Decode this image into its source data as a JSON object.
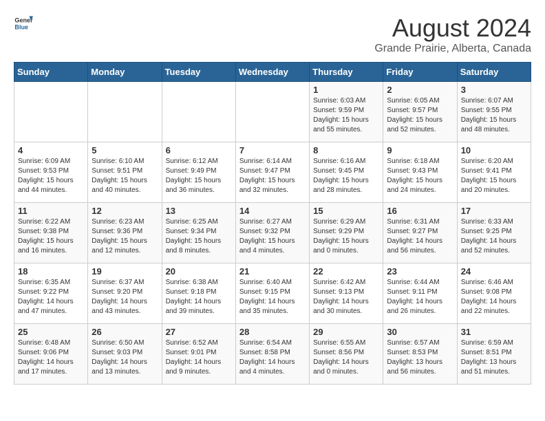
{
  "header": {
    "logo_general": "General",
    "logo_blue": "Blue",
    "month_year": "August 2024",
    "location": "Grande Prairie, Alberta, Canada"
  },
  "calendar": {
    "weekdays": [
      "Sunday",
      "Monday",
      "Tuesday",
      "Wednesday",
      "Thursday",
      "Friday",
      "Saturday"
    ],
    "weeks": [
      [
        {
          "day": "",
          "info": ""
        },
        {
          "day": "",
          "info": ""
        },
        {
          "day": "",
          "info": ""
        },
        {
          "day": "",
          "info": ""
        },
        {
          "day": "1",
          "info": "Sunrise: 6:03 AM\nSunset: 9:59 PM\nDaylight: 15 hours\nand 55 minutes."
        },
        {
          "day": "2",
          "info": "Sunrise: 6:05 AM\nSunset: 9:57 PM\nDaylight: 15 hours\nand 52 minutes."
        },
        {
          "day": "3",
          "info": "Sunrise: 6:07 AM\nSunset: 9:55 PM\nDaylight: 15 hours\nand 48 minutes."
        }
      ],
      [
        {
          "day": "4",
          "info": "Sunrise: 6:09 AM\nSunset: 9:53 PM\nDaylight: 15 hours\nand 44 minutes."
        },
        {
          "day": "5",
          "info": "Sunrise: 6:10 AM\nSunset: 9:51 PM\nDaylight: 15 hours\nand 40 minutes."
        },
        {
          "day": "6",
          "info": "Sunrise: 6:12 AM\nSunset: 9:49 PM\nDaylight: 15 hours\nand 36 minutes."
        },
        {
          "day": "7",
          "info": "Sunrise: 6:14 AM\nSunset: 9:47 PM\nDaylight: 15 hours\nand 32 minutes."
        },
        {
          "day": "8",
          "info": "Sunrise: 6:16 AM\nSunset: 9:45 PM\nDaylight: 15 hours\nand 28 minutes."
        },
        {
          "day": "9",
          "info": "Sunrise: 6:18 AM\nSunset: 9:43 PM\nDaylight: 15 hours\nand 24 minutes."
        },
        {
          "day": "10",
          "info": "Sunrise: 6:20 AM\nSunset: 9:41 PM\nDaylight: 15 hours\nand 20 minutes."
        }
      ],
      [
        {
          "day": "11",
          "info": "Sunrise: 6:22 AM\nSunset: 9:38 PM\nDaylight: 15 hours\nand 16 minutes."
        },
        {
          "day": "12",
          "info": "Sunrise: 6:23 AM\nSunset: 9:36 PM\nDaylight: 15 hours\nand 12 minutes."
        },
        {
          "day": "13",
          "info": "Sunrise: 6:25 AM\nSunset: 9:34 PM\nDaylight: 15 hours\nand 8 minutes."
        },
        {
          "day": "14",
          "info": "Sunrise: 6:27 AM\nSunset: 9:32 PM\nDaylight: 15 hours\nand 4 minutes."
        },
        {
          "day": "15",
          "info": "Sunrise: 6:29 AM\nSunset: 9:29 PM\nDaylight: 15 hours\nand 0 minutes."
        },
        {
          "day": "16",
          "info": "Sunrise: 6:31 AM\nSunset: 9:27 PM\nDaylight: 14 hours\nand 56 minutes."
        },
        {
          "day": "17",
          "info": "Sunrise: 6:33 AM\nSunset: 9:25 PM\nDaylight: 14 hours\nand 52 minutes."
        }
      ],
      [
        {
          "day": "18",
          "info": "Sunrise: 6:35 AM\nSunset: 9:22 PM\nDaylight: 14 hours\nand 47 minutes."
        },
        {
          "day": "19",
          "info": "Sunrise: 6:37 AM\nSunset: 9:20 PM\nDaylight: 14 hours\nand 43 minutes."
        },
        {
          "day": "20",
          "info": "Sunrise: 6:38 AM\nSunset: 9:18 PM\nDaylight: 14 hours\nand 39 minutes."
        },
        {
          "day": "21",
          "info": "Sunrise: 6:40 AM\nSunset: 9:15 PM\nDaylight: 14 hours\nand 35 minutes."
        },
        {
          "day": "22",
          "info": "Sunrise: 6:42 AM\nSunset: 9:13 PM\nDaylight: 14 hours\nand 30 minutes."
        },
        {
          "day": "23",
          "info": "Sunrise: 6:44 AM\nSunset: 9:11 PM\nDaylight: 14 hours\nand 26 minutes."
        },
        {
          "day": "24",
          "info": "Sunrise: 6:46 AM\nSunset: 9:08 PM\nDaylight: 14 hours\nand 22 minutes."
        }
      ],
      [
        {
          "day": "25",
          "info": "Sunrise: 6:48 AM\nSunset: 9:06 PM\nDaylight: 14 hours\nand 17 minutes."
        },
        {
          "day": "26",
          "info": "Sunrise: 6:50 AM\nSunset: 9:03 PM\nDaylight: 14 hours\nand 13 minutes."
        },
        {
          "day": "27",
          "info": "Sunrise: 6:52 AM\nSunset: 9:01 PM\nDaylight: 14 hours\nand 9 minutes."
        },
        {
          "day": "28",
          "info": "Sunrise: 6:54 AM\nSunset: 8:58 PM\nDaylight: 14 hours\nand 4 minutes."
        },
        {
          "day": "29",
          "info": "Sunrise: 6:55 AM\nSunset: 8:56 PM\nDaylight: 14 hours\nand 0 minutes."
        },
        {
          "day": "30",
          "info": "Sunrise: 6:57 AM\nSunset: 8:53 PM\nDaylight: 13 hours\nand 56 minutes."
        },
        {
          "day": "31",
          "info": "Sunrise: 6:59 AM\nSunset: 8:51 PM\nDaylight: 13 hours\nand 51 minutes."
        }
      ]
    ]
  }
}
